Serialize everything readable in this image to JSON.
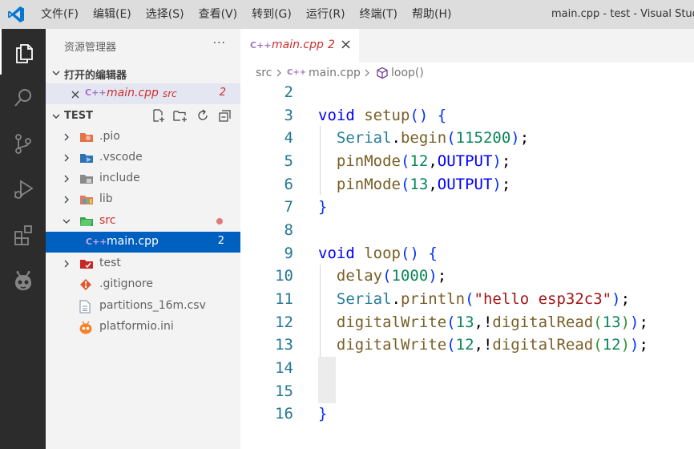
{
  "window": {
    "title": "main.cpp - test - Visual Studi"
  },
  "menu": [
    "文件(F)",
    "编辑(E)",
    "选择(S)",
    "查看(V)",
    "转到(G)",
    "运行(R)",
    "终端(T)",
    "帮助(H)"
  ],
  "colors": {
    "accent": "#0060c0",
    "activity_bg": "#2c2c2c",
    "error": "#cc2f2f",
    "titlebar": "#dddddd"
  },
  "activity_icons": [
    "explorer-icon",
    "search-icon",
    "source-control-icon",
    "run-debug-icon",
    "extensions-icon",
    "platformio-icon"
  ],
  "sidebar": {
    "title": "资源管理器",
    "more": "···",
    "open_editors": {
      "label": "打开的编辑器",
      "items": [
        {
          "name": "main.cpp",
          "folder": "src",
          "problems": "2"
        }
      ]
    },
    "workspace": {
      "label": "TEST",
      "items": [
        {
          "name": ".pio",
          "icon": "folder-pio-icon",
          "expanded": false
        },
        {
          "name": ".vscode",
          "icon": "folder-vscode-icon",
          "expanded": false
        },
        {
          "name": "include",
          "icon": "folder-include-icon",
          "expanded": false
        },
        {
          "name": "lib",
          "icon": "folder-lib-icon",
          "expanded": false
        },
        {
          "name": "src",
          "icon": "folder-src-icon",
          "expanded": true,
          "modified": true
        },
        {
          "name": "main.cpp",
          "icon": "cpp-file-icon",
          "problems": "2",
          "selected": true
        },
        {
          "name": "test",
          "icon": "folder-test-icon",
          "expanded": false
        },
        {
          "name": ".gitignore",
          "icon": "git-icon"
        },
        {
          "name": "partitions_16m.csv",
          "icon": "file-icon"
        },
        {
          "name": "platformio.ini",
          "icon": "platformio-file-icon"
        }
      ]
    }
  },
  "editor": {
    "tab": {
      "name": "main.cpp",
      "problems": "2",
      "close": "×"
    },
    "breadcrumb": [
      "src",
      "main.cpp",
      "loop()"
    ],
    "line_numbers": [
      "2",
      "3",
      "4",
      "5",
      "6",
      "7",
      "8",
      "9",
      "10",
      "11",
      "12",
      "13",
      "14",
      "15",
      "16"
    ],
    "lines": [
      "",
      "void setup() {",
      "  Serial.begin(115200);",
      "  pinMode(12,OUTPUT);",
      "  pinMode(13,OUTPUT);",
      "}",
      "",
      "void loop() {",
      "  delay(1000);",
      "  Serial.println(\"hello esp32c3\");",
      "  digitalWrite(13,!digitalRead(13));",
      "  digitalWrite(12,!digitalRead(12));",
      "",
      "",
      "}"
    ]
  }
}
